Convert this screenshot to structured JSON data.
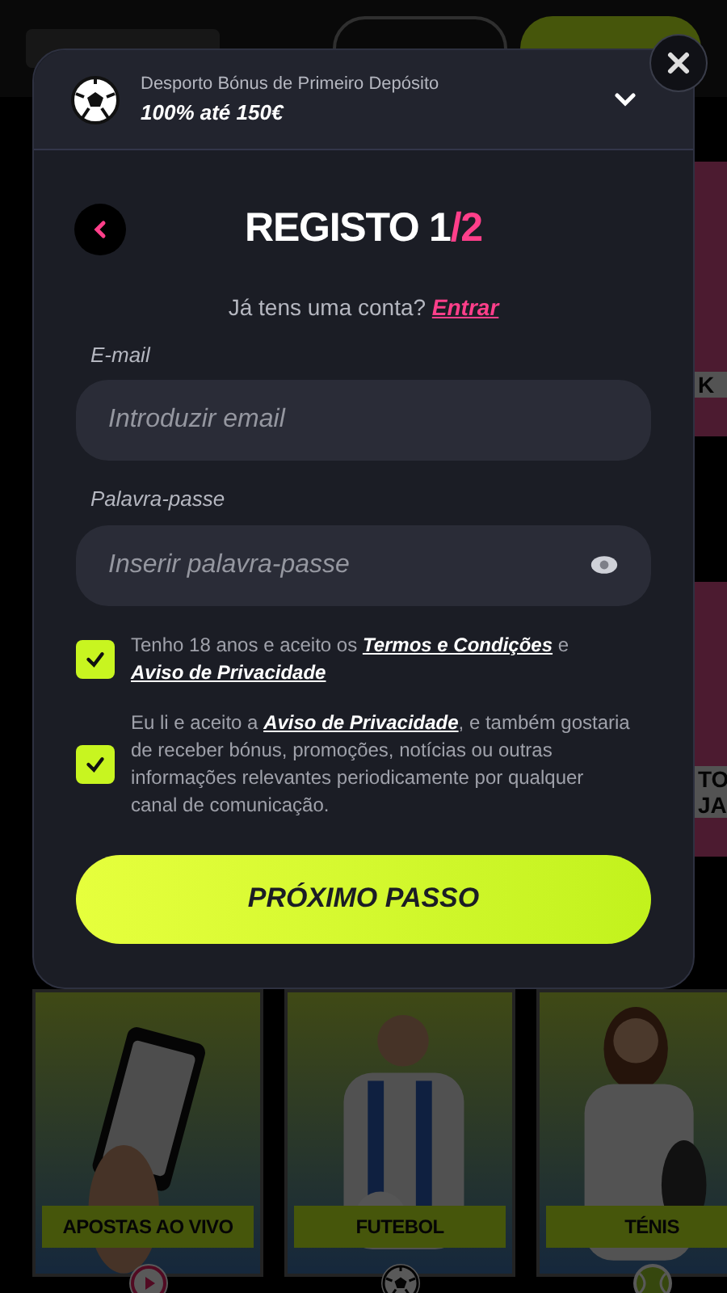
{
  "bonus": {
    "subtitle": "Desporto Bónus de Primeiro Depósito",
    "offer": "100% até 150€"
  },
  "title": {
    "main": "REGISTO 1",
    "suffix": "/2"
  },
  "login_prompt": {
    "text": "Já tens uma conta?",
    "link": "Entrar"
  },
  "fields": [
    {
      "label": "E-mail",
      "placeholder": "Introduzir email",
      "kind": "email"
    },
    {
      "label": "Palavra-passe",
      "placeholder": "Inserir palavra-passe",
      "kind": "password"
    }
  ],
  "consents": [
    {
      "checked": true,
      "parts": [
        {
          "text": "Tenho 18 anos e aceito os ",
          "link": false
        },
        {
          "text": "Termos e Condições",
          "link": true
        },
        {
          "text": " e ",
          "link": false
        },
        {
          "text": "Aviso de Privacidade",
          "link": true
        }
      ]
    },
    {
      "checked": true,
      "parts": [
        {
          "text": "Eu li e aceito a ",
          "link": false
        },
        {
          "text": "Aviso de Privacidade",
          "link": true
        },
        {
          "text": ", e também gostaria de receber bónus, promoções, notícias ou outras informações relevantes periodicamente por qualquer canal de comunicação.",
          "link": false
        }
      ]
    }
  ],
  "next_button": "PRÓXIMO PASSO",
  "side_cards": [
    {
      "lines": [
        "K"
      ]
    },
    {
      "lines": [
        "TO",
        "JA"
      ]
    }
  ],
  "sport_cards": [
    {
      "label": "APOSTAS AO VIVO",
      "kind": "live"
    },
    {
      "label": "FUTEBOL",
      "kind": "football"
    },
    {
      "label": "TÉNIS",
      "kind": "tennis"
    }
  ]
}
